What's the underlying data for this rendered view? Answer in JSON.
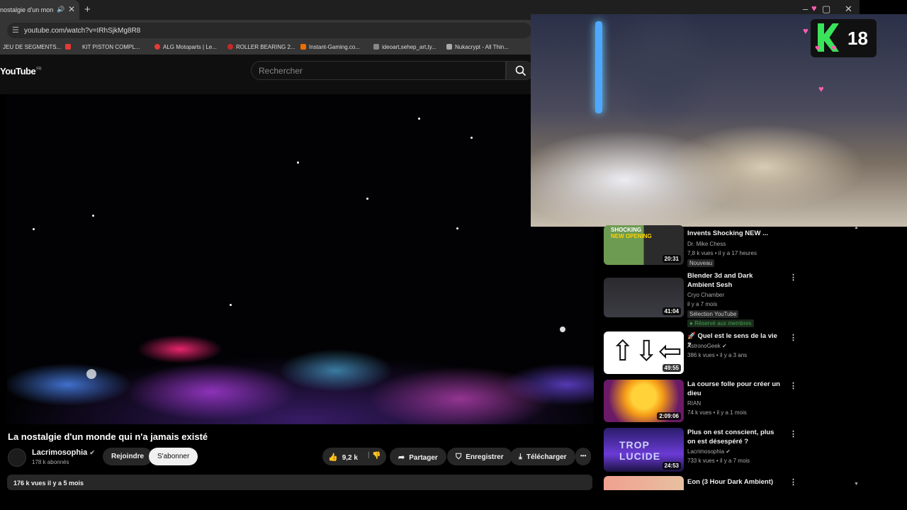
{
  "browser": {
    "tab_title": "nostalgie d'un monde",
    "close": "✕",
    "new_tab": "+",
    "url": "youtube.com/watch?v=IRhSjkMg8R8",
    "bookmarks": [
      {
        "label": "JEU DE SEGMENTS...",
        "color": "#888"
      },
      {
        "label": "KIT PISTON COMPL...",
        "color": "#c0392b"
      },
      {
        "label": "ALG Motoparts | Le...",
        "color": "#e74c3c"
      },
      {
        "label": "ROLLER BEARING 2...",
        "color": "#c0392b"
      },
      {
        "label": "Instant-Gaming.co...",
        "color": "#e67e22"
      },
      {
        "label": "ideoart,sehep_art,ty...",
        "color": "#555"
      },
      {
        "label": "Nukacrypt - All Thin...",
        "color": "#888"
      }
    ],
    "window_controls": [
      "–",
      "▢",
      "✕"
    ]
  },
  "youtube": {
    "logo": "YouTube",
    "region": "FR",
    "search_placeholder": "Rechercher",
    "video_title": "La nostalgie d'un monde qui n'a jamais existé",
    "channel_name": "Lacrimosophia",
    "channel_subs": "178 k abonnés",
    "join": "Rejoindre",
    "subscribe": "S'abonner",
    "likes": "9,2 k",
    "share": "Partager",
    "save": "Enregistrer",
    "download": "Télécharger",
    "more": "•••",
    "description_stats": "176 k vues  il y a 5 mois"
  },
  "overlay": {
    "badge_number": "18"
  },
  "recommendations": [
    {
      "title": "Invents Shocking NEW ...",
      "channel": "Dr. Mike Chess",
      "meta": "7,8 k vues • il y a 17 heures",
      "duration": "20:31",
      "tag": "Nouveau",
      "thumb_label": "SHOCKING NEW OPENING"
    },
    {
      "title": "Blender 3d and Dark Ambient Sesh",
      "channel": "Cryo Chamber",
      "meta": "il y a 7 mois",
      "duration": "41:04",
      "tag": "Sélection YouTube",
      "tag2": "Réservé aux membres"
    },
    {
      "title": "🚀 Quel est le sens de la vie ?",
      "channel": "AstronoGeek",
      "meta": "386 k vues • il y a 3 ans",
      "duration": "49:55"
    },
    {
      "title": "La course folle pour créer un dieu",
      "channel": "RIAN",
      "meta": "74 k vues • il y a 1 mois",
      "duration": "2:09:06"
    },
    {
      "title": "Plus on est conscient, plus on est désespéré ?",
      "channel": "Lacrimosophia",
      "meta": "733 k vues • il y a 7 mois",
      "duration": "24:53",
      "thumb_label": "TROP LUCIDE"
    },
    {
      "title": "Eon (3 Hour Dark Ambient)"
    }
  ]
}
